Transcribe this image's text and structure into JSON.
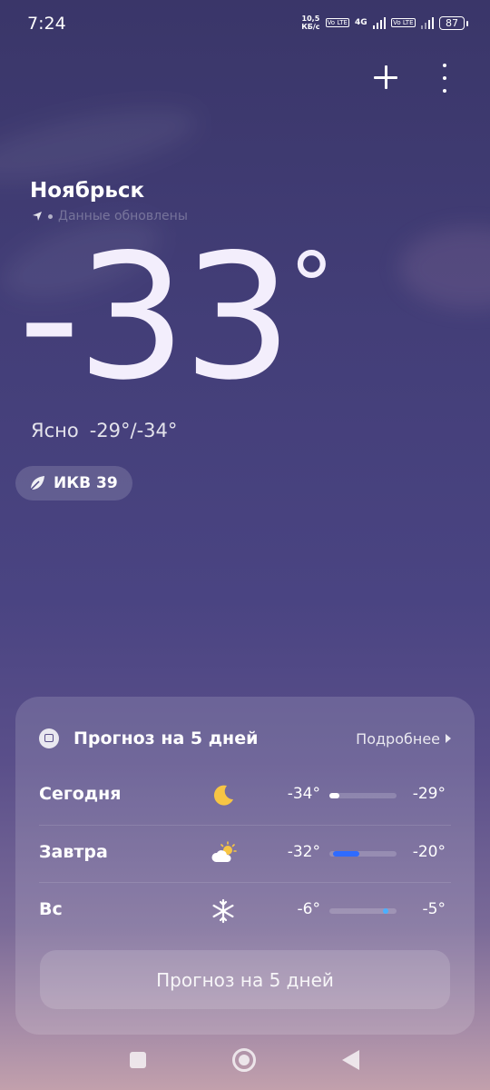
{
  "status_bar": {
    "time": "7:24",
    "speed_value": "10,5",
    "speed_unit": "КБ/с",
    "volte1": "Vo LTE",
    "network": "4G",
    "volte2": "Vo LTE",
    "battery": "87"
  },
  "location": {
    "city": "Ноябрьск",
    "subtitle": "Данные обновлены"
  },
  "current": {
    "temperature": "-33",
    "degree_symbol": "°",
    "condition": "Ясно",
    "range": "-29°/-34°"
  },
  "aqi": {
    "label": "ИКВ 39"
  },
  "forecast": {
    "title": "Прогноз на 5 дней",
    "more_label": "Подробнее",
    "button_label": "Прогноз на 5 дней",
    "days": [
      {
        "day": "Сегодня",
        "icon": "moon-icon",
        "low": "-34°",
        "high": "-29°",
        "bar_start": 0.0,
        "bar_end": 0.15,
        "bar_color": "#ffffff"
      },
      {
        "day": "Завтра",
        "icon": "partly-cloudy-icon",
        "low": "-32°",
        "high": "-20°",
        "bar_start": 0.05,
        "bar_end": 0.45,
        "bar_color": "#2f6bff"
      },
      {
        "day": "Вс",
        "icon": "snowflake-icon",
        "low": "-6°",
        "high": "-5°",
        "bar_start": 0.8,
        "bar_end": 0.84,
        "bar_color": "#4ab0ff"
      }
    ]
  },
  "colors": {
    "moon": "#f7c544",
    "sun": "#f7c544",
    "accent_blue": "#2f6bff"
  }
}
